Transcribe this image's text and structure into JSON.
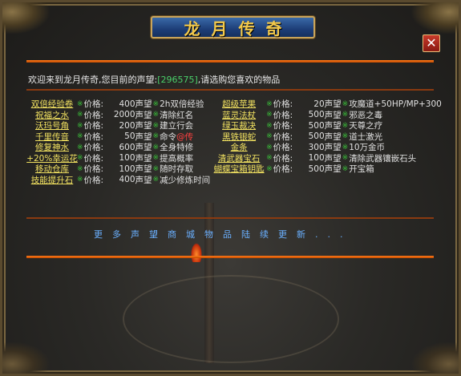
{
  "title": "龙月传奇",
  "close_label": "✕",
  "welcome": {
    "prefix": "欢迎来到龙月传奇,您目前的声望:",
    "reputation": "[296575]",
    "suffix": ",请选购您喜欢的物品"
  },
  "items": [
    [
      "双倍经验卷",
      "价格:",
      "400",
      "声望",
      "2h双倍经验",
      "超级苹果",
      "价格:",
      "20",
      "声望",
      "攻魔道+50HP/MP+300"
    ],
    [
      "祝福之水",
      "价格:",
      "2000",
      "声望",
      "清除红名",
      "蓝灵法杖",
      "价格:",
      "500",
      "声望",
      "邪恶之毒"
    ],
    [
      "沃玛号角",
      "价格:",
      "200",
      "声望",
      "建立行会",
      "绿玉裁决",
      "价格:",
      "500",
      "声望",
      "天尊之疗"
    ],
    [
      "千里传音",
      "价格:",
      "50",
      "声望",
      "命令 @传",
      "黑铁银蛇",
      "价格:",
      "500",
      "声望",
      "道士激光"
    ],
    [
      "修复神水",
      "价格:",
      "600",
      "声望",
      "全身特修",
      "金条",
      "价格:",
      "300",
      "声望",
      "10万金币"
    ],
    [
      "+20%幸运花",
      "价格:",
      "100",
      "声望",
      "提高概率",
      "清武器宝石",
      "价格:",
      "100",
      "声望",
      "清除武器镶嵌石头"
    ],
    [
      "移动仓库",
      "价格:",
      "100",
      "声望",
      "随时存取",
      "蝴蝶宝箱钥匙",
      "价格:",
      "500",
      "声望",
      "开宝箱"
    ],
    [
      "技能提升石",
      "价格:",
      "400",
      "声望",
      "减少修炼时间",
      "",
      "",
      "",
      "",
      ""
    ]
  ],
  "more_text": "更多声望商城物品陆续更新..."
}
